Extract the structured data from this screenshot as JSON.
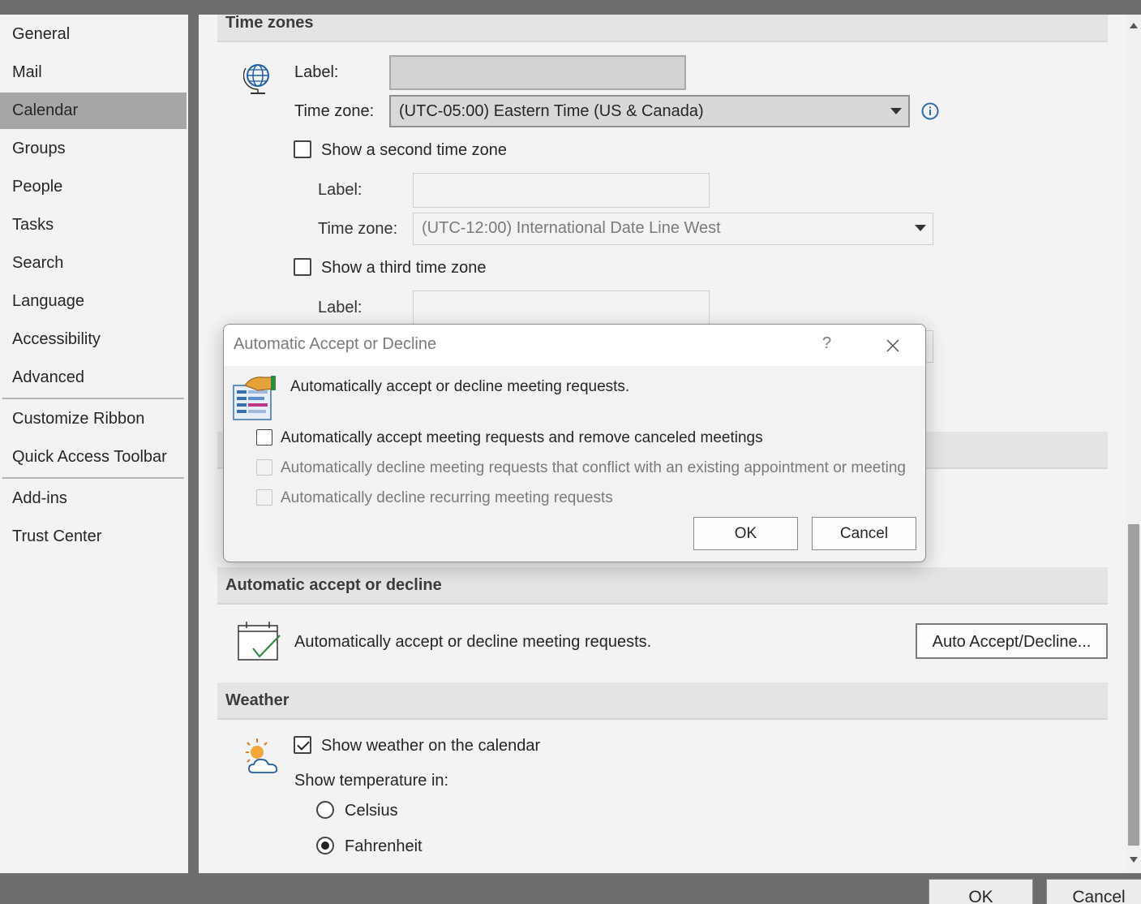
{
  "sidebar": {
    "items": [
      {
        "label": "General"
      },
      {
        "label": "Mail"
      },
      {
        "label": "Calendar",
        "selected": true
      },
      {
        "label": "Groups"
      },
      {
        "label": "People"
      },
      {
        "label": "Tasks"
      },
      {
        "label": "Search"
      },
      {
        "label": "Language"
      },
      {
        "label": "Accessibility"
      },
      {
        "label": "Advanced"
      },
      {
        "label": "Customize Ribbon"
      },
      {
        "label": "Quick Access Toolbar"
      },
      {
        "label": "Add-ins"
      },
      {
        "label": "Trust Center"
      }
    ]
  },
  "time_zones": {
    "header": "Time zones",
    "primary": {
      "label_caption": "Label:",
      "label_value": "",
      "zone_caption": "Time zone:",
      "zone_value": "(UTC-05:00) Eastern Time (US & Canada)"
    },
    "second": {
      "checkbox_label": "Show a second time zone",
      "checked": false,
      "label_caption": "Label:",
      "label_value": "",
      "zone_caption": "Time zone:",
      "zone_value": "(UTC-12:00) International Date Line West"
    },
    "third": {
      "checkbox_label": "Show a third time zone",
      "checked": false,
      "label_caption": "Label:",
      "label_value": ""
    }
  },
  "auto_accept": {
    "header": "Automatic accept or decline",
    "description": "Automatically accept or decline meeting requests.",
    "button_label": "Auto Accept/Decline..."
  },
  "weather": {
    "header": "Weather",
    "show_weather_label": "Show weather on the calendar",
    "show_weather_checked": true,
    "temperature_caption": "Show temperature in:",
    "options": [
      {
        "label": "Celsius",
        "selected": false
      },
      {
        "label": "Fahrenheit",
        "selected": true
      }
    ]
  },
  "footer": {
    "ok_label": "OK",
    "cancel_label": "Cancel"
  },
  "dialog": {
    "title": "Automatic Accept or Decline",
    "help_glyph": "?",
    "heading": "Automatically accept or decline meeting requests.",
    "options": [
      {
        "label": "Automatically accept meeting requests and remove canceled meetings",
        "checked": false,
        "enabled": true
      },
      {
        "label": "Automatically decline meeting requests that conflict with an existing appointment or meeting",
        "checked": false,
        "enabled": false
      },
      {
        "label": "Automatically decline recurring meeting requests",
        "checked": false,
        "enabled": false
      }
    ],
    "ok_label": "OK",
    "cancel_label": "Cancel"
  },
  "colors": {
    "window_frame": "#6d6d6d",
    "panel_background": "#f3f3f3",
    "selected_nav": "#a6a6a6",
    "section_header": "#e4e4e4",
    "info_icon": "#2b6cb0"
  }
}
